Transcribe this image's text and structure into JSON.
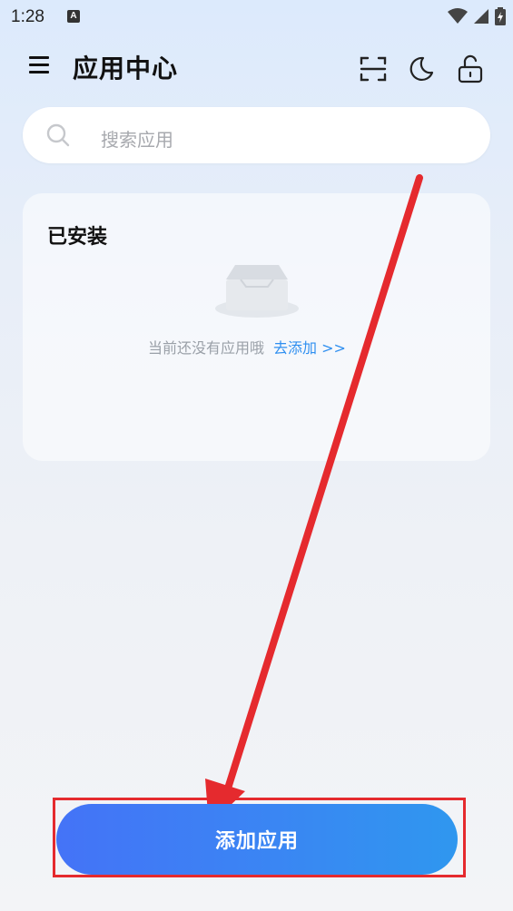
{
  "status_bar": {
    "time": "1:28",
    "notification_icon": "A",
    "icons": [
      "wifi-icon",
      "signal-icon",
      "battery-charging-icon"
    ]
  },
  "header": {
    "title": "应用中心",
    "icons": [
      "menu-icon",
      "scan-icon",
      "moon-icon",
      "unlock-icon"
    ]
  },
  "search": {
    "placeholder": "搜索应用"
  },
  "installed": {
    "title": "已安装",
    "empty_text": "当前还没有应用哦",
    "add_link": "去添加 >>"
  },
  "cta": {
    "label": "添加应用"
  },
  "colors": {
    "accent": "#3a86f3",
    "link": "#2f8ff0",
    "annotation": "#e52a2e"
  }
}
